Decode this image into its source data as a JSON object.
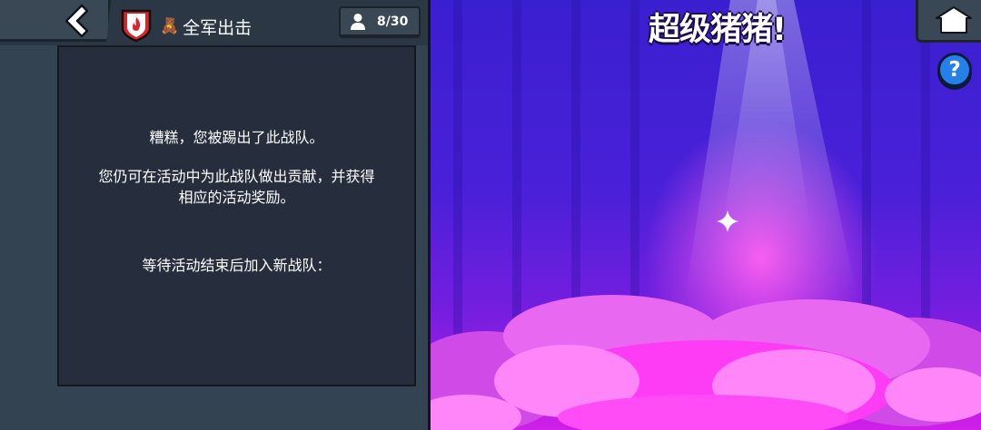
{
  "header": {
    "club_name": "全军出击",
    "member_count": "8/30"
  },
  "message": {
    "line1": "糟糕，您被踢出了此战队。",
    "line2": "您仍可在活动中为此战队做出贡献，并获得相应的活动奖励。",
    "line3": "等待活动结束后加入新战队："
  },
  "event": {
    "title": "超级猪猪!"
  },
  "help": {
    "label": "?"
  },
  "icons": {
    "back": "chevron-left-icon",
    "club_badge": "flame-shield-icon",
    "club_emoji": "teddy-bear-icon",
    "member": "person-icon",
    "home": "home-icon",
    "help": "question-mark-icon",
    "sparkle": "sparkle-icon"
  },
  "colors": {
    "panel_bg": "#334352",
    "message_bg": "#262d3c",
    "badge_red": "#d6262c",
    "help_blue": "#2580e8",
    "cloud_pink": "#ff6ef6"
  }
}
